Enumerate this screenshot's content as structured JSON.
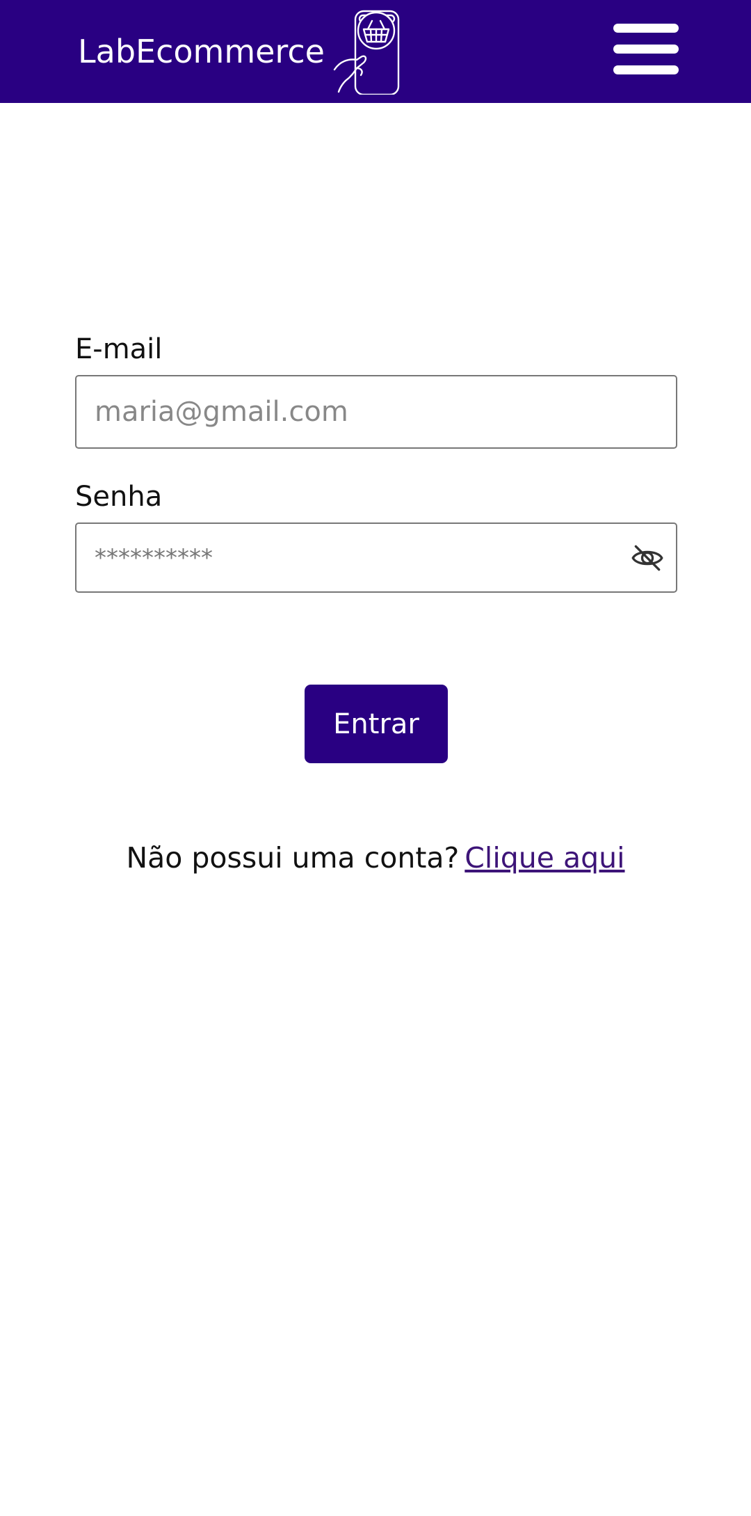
{
  "header": {
    "brand_name": "LabEcommerce",
    "background_color": "#290082",
    "logo_icon": "basket-phone-icon",
    "menu_icon": "hamburger-menu-icon"
  },
  "login_form": {
    "email": {
      "label": "E-mail",
      "placeholder": "maria@gmail.com",
      "value": ""
    },
    "password": {
      "label": "Senha",
      "placeholder": "**********",
      "value": "",
      "toggle_icon": "eye-off-icon"
    },
    "submit_label": "Entrar",
    "submit_color": "#290082"
  },
  "signup": {
    "prompt": "Não possui uma conta?",
    "link_label": "Clique aqui",
    "link_color": "#3d1478"
  }
}
